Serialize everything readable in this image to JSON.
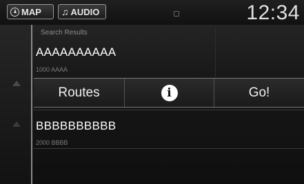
{
  "header": {
    "map_label": "MAP",
    "audio_label": "AUDIO",
    "clock": "12:34"
  },
  "list": {
    "section_title": "Search Results",
    "items": [
      {
        "title": "AAAAAAAAAA",
        "subtitle": "1000 AAAA"
      },
      {
        "title": "BBBBBBBBBB",
        "subtitle": "2000 BBBB"
      }
    ]
  },
  "actions": {
    "routes_label": "Routes",
    "info_icon": "i",
    "go_label": "Go!"
  }
}
